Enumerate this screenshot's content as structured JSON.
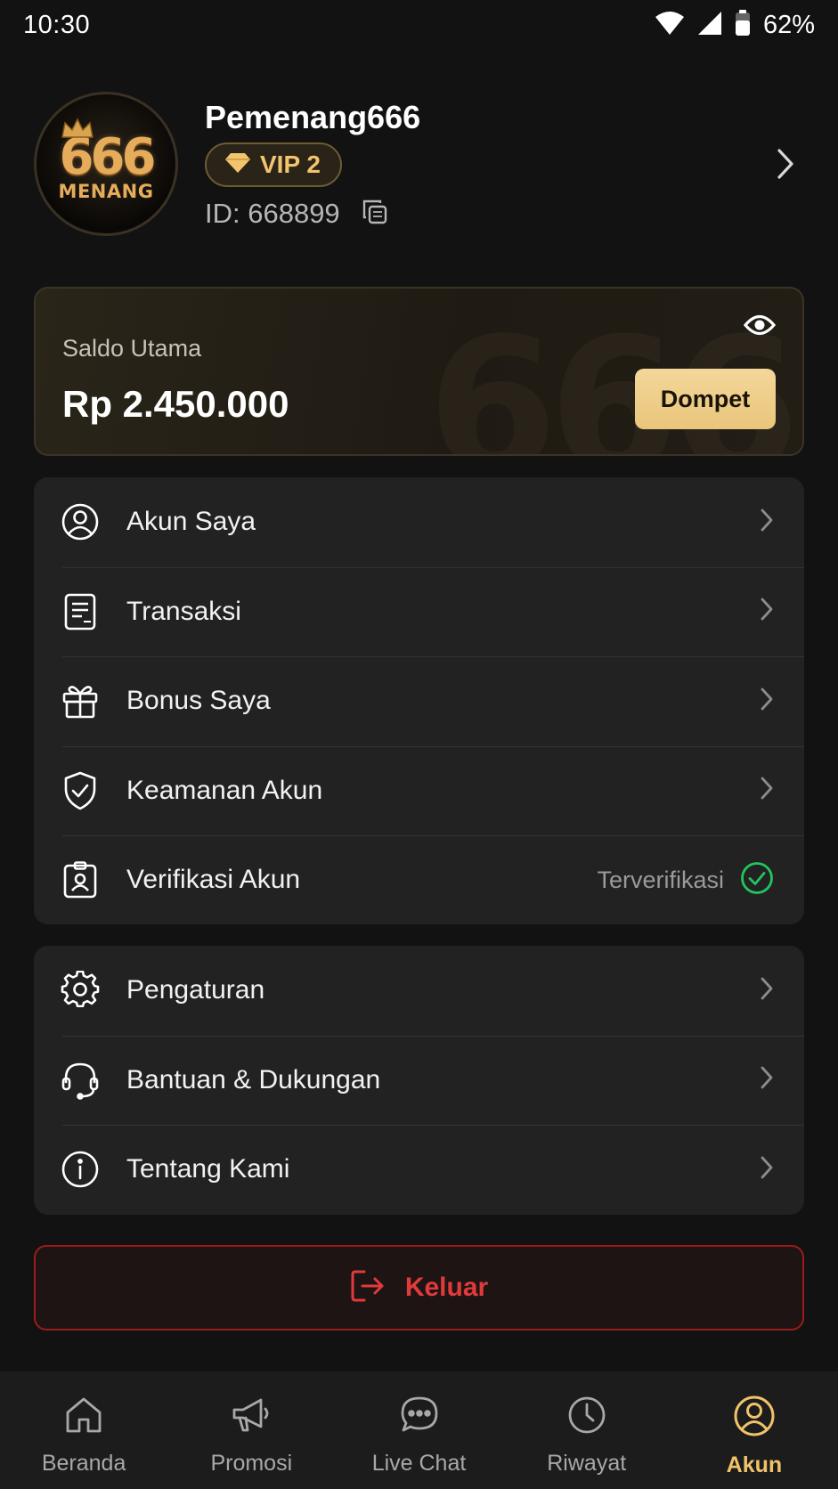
{
  "status_bar": {
    "time": "10:30",
    "battery": "62%"
  },
  "profile": {
    "avatar_number": "666",
    "avatar_text": "MENANG",
    "username": "Pemenang666",
    "vip_label": "VIP 2",
    "id_text": "ID: 668899"
  },
  "balance": {
    "label": "Saldo Utama",
    "value": "Rp 2.450.000",
    "watermark": "666",
    "button_label": "Dompet"
  },
  "menu_group_1": [
    {
      "label": "Akun Saya",
      "icon": "user-circle-icon"
    },
    {
      "label": "Transaksi",
      "icon": "receipt-icon"
    },
    {
      "label": "Bonus Saya",
      "icon": "gift-icon"
    },
    {
      "label": "Keamanan Akun",
      "icon": "shield-check-icon"
    },
    {
      "label": "Verifikasi Akun",
      "icon": "id-badge-icon",
      "status": "Terverifikasi"
    }
  ],
  "menu_group_2": [
    {
      "label": "Pengaturan",
      "icon": "gear-icon"
    },
    {
      "label": "Bantuan & Dukungan",
      "icon": "headset-icon"
    },
    {
      "label": "Tentang Kami",
      "icon": "info-icon"
    }
  ],
  "logout": {
    "label": "Keluar"
  },
  "bottom_nav": [
    {
      "label": "Beranda",
      "icon": "home-icon"
    },
    {
      "label": "Promosi",
      "icon": "megaphone-icon"
    },
    {
      "label": "Live Chat",
      "icon": "chat-bubble-icon"
    },
    {
      "label": "Riwayat",
      "icon": "clock-icon"
    },
    {
      "label": "Akun",
      "icon": "user-circle-icon",
      "active": true
    }
  ],
  "colors": {
    "background": "#121212",
    "card": "#222222",
    "gold_accent": "#f0c26a",
    "danger": "#e23a3a",
    "success": "#22c55e"
  }
}
